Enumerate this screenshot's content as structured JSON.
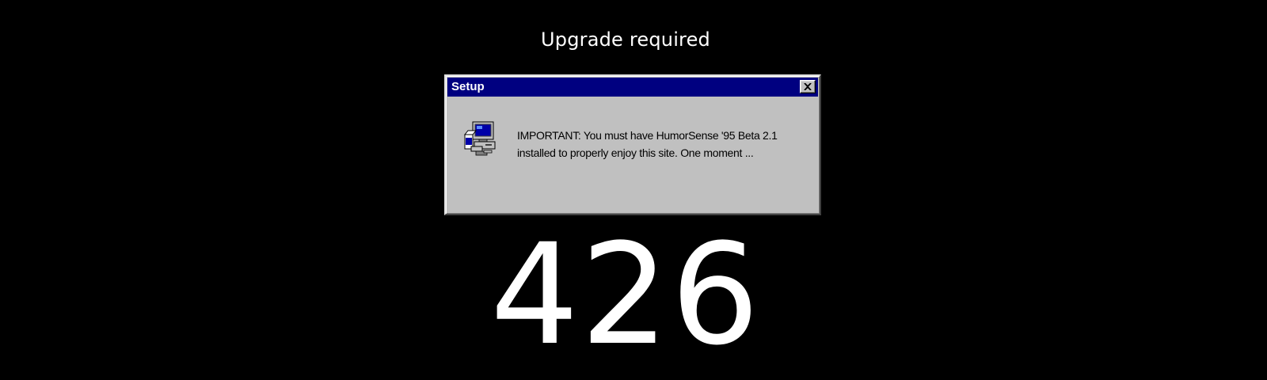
{
  "page": {
    "heading": "Upgrade required",
    "status_code": "426"
  },
  "dialog": {
    "title": "Setup",
    "close_icon": "close-x-icon",
    "app_icon": "setup-computer-icon",
    "message_line1": "IMPORTANT: You must have HumorSense '95 Beta 2.1",
    "message_line2": "installed to properly enjoy this site.  One moment ..."
  },
  "colors": {
    "background": "#000000",
    "titlebar": "#000080",
    "dialog_face": "#c0c0c0",
    "text_light": "#ffffff"
  }
}
